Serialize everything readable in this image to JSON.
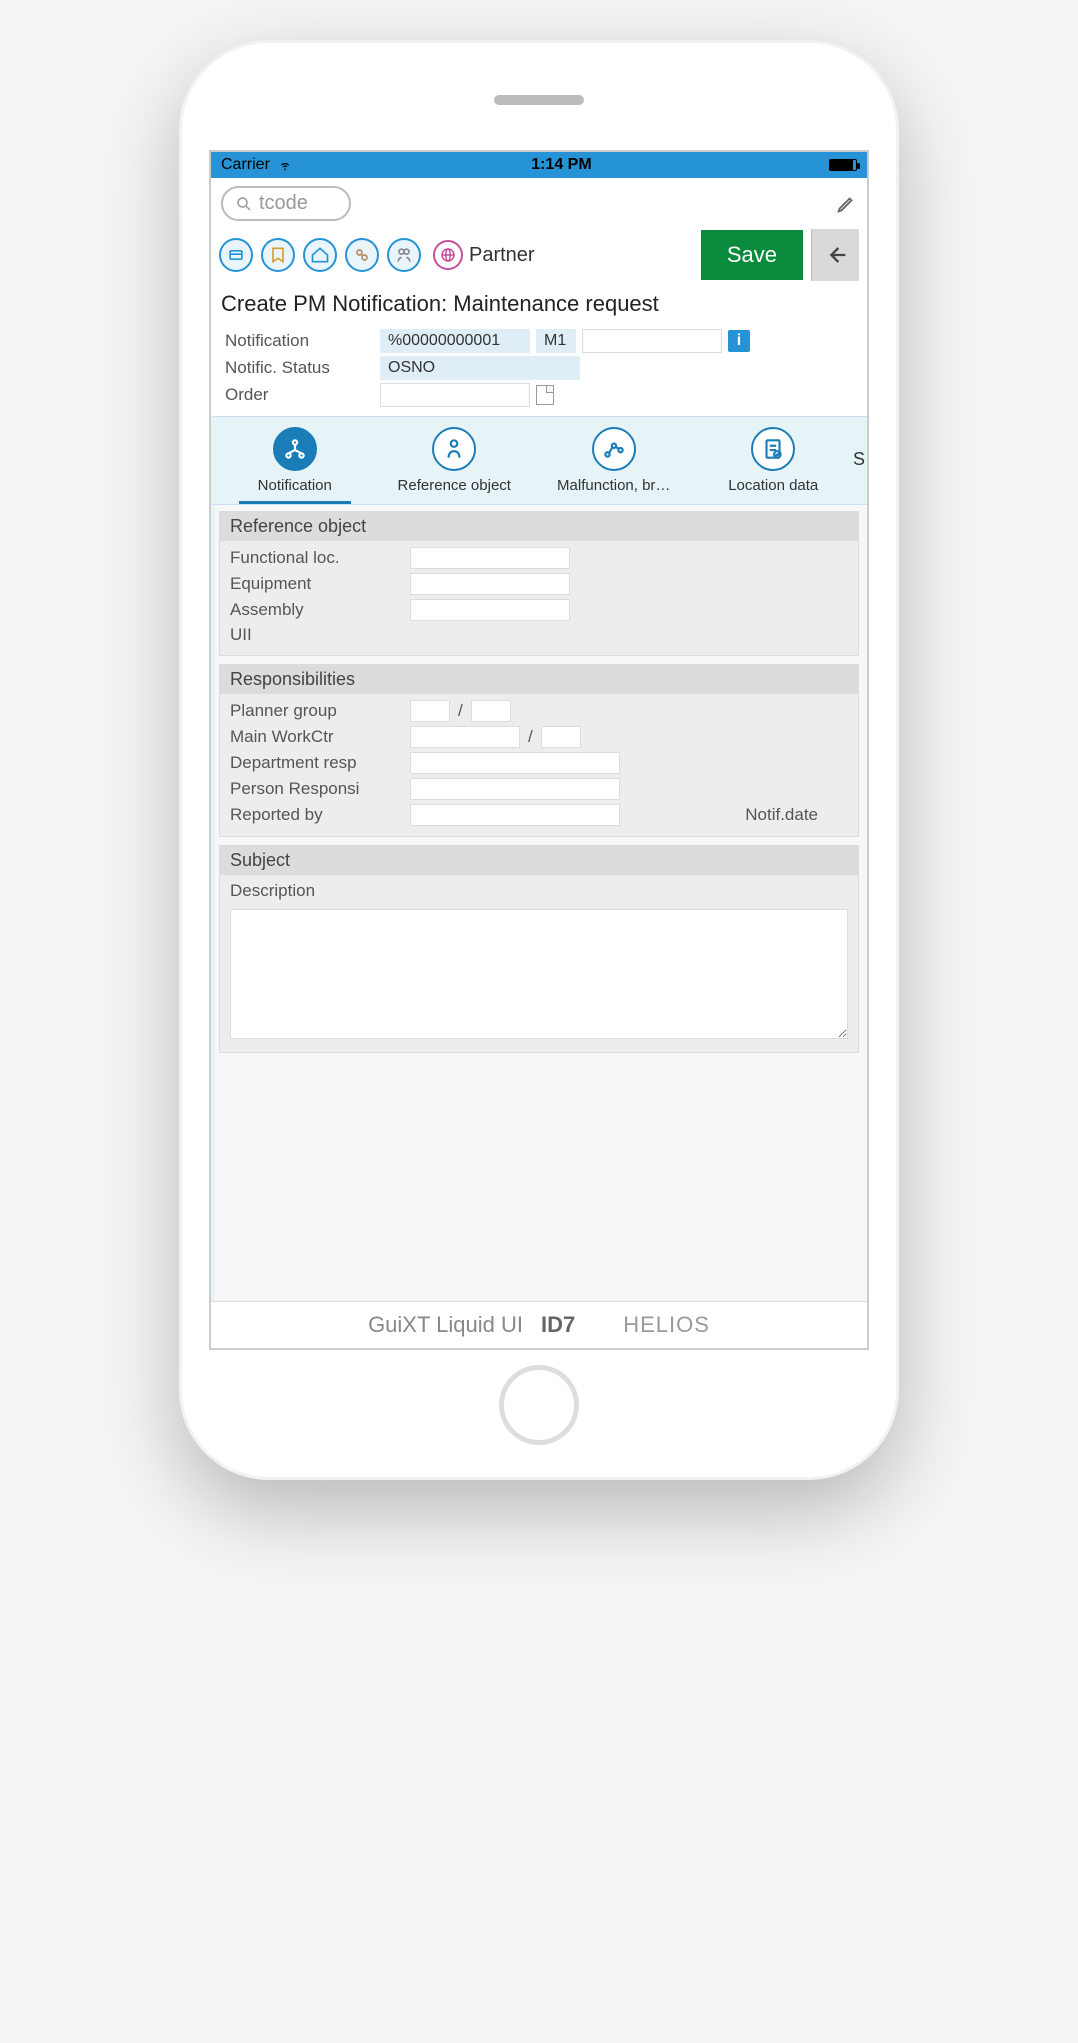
{
  "statusBar": {
    "carrier": "Carrier",
    "time": "1:14 PM"
  },
  "toolbar": {
    "searchPlaceholder": "tcode",
    "partnerLabel": "Partner",
    "saveLabel": "Save"
  },
  "pageTitle": "Create PM Notification: Maintenance request",
  "headerFields": {
    "notification": {
      "label": "Notification",
      "value": "%00000000001",
      "type": "M1"
    },
    "notificStatus": {
      "label": "Notific. Status",
      "value": "OSNO"
    },
    "order": {
      "label": "Order",
      "value": ""
    }
  },
  "tabs": [
    {
      "label": "Notification",
      "active": true
    },
    {
      "label": "Reference object",
      "active": false
    },
    {
      "label": "Malfunction, br…",
      "active": false
    },
    {
      "label": "Location data",
      "active": false
    }
  ],
  "tabExtra": "S",
  "sections": {
    "referenceObject": {
      "title": "Reference object",
      "fields": {
        "functionalLoc": "Functional loc.",
        "equipment": "Equipment",
        "assembly": "Assembly",
        "uii": "UII"
      }
    },
    "responsibilities": {
      "title": "Responsibilities",
      "fields": {
        "plannerGroup": "Planner group",
        "mainWorkCtr": "Main WorkCtr",
        "departmentResp": "Department resp",
        "personResponsi": "Person Responsi",
        "reportedBy": "Reported by",
        "notifDate": "Notif.date"
      }
    },
    "subject": {
      "title": "Subject",
      "descriptionLabel": "Description"
    }
  },
  "footer": {
    "brand1": "GuiXT Liquid UI",
    "brand2": "ID7",
    "brand3": "HELIOS"
  }
}
